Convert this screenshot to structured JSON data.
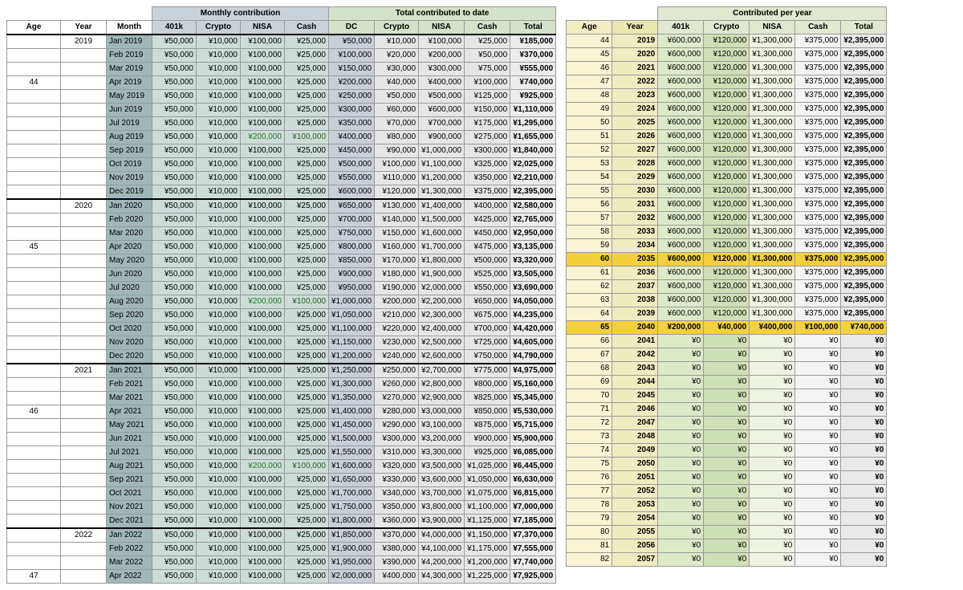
{
  "left": {
    "sup_headers": [
      "Monthly contribution",
      "Total contributed to date"
    ],
    "headers": [
      "Age",
      "Year",
      "Month",
      "401k",
      "Crypto",
      "NISA",
      "Cash",
      "DC",
      "Crypto",
      "NISA",
      "Cash",
      "Total"
    ],
    "ageMonth": 4,
    "ageStart": 44,
    "years": [
      {
        "year": 2019,
        "401k": 50000,
        "crypto": 10000,
        "nisa_base": 100000,
        "nisa_aug": 200000,
        "cash_base": 25000,
        "cash_aug": 100000
      },
      {
        "year": 2020,
        "401k": 50000,
        "crypto": 10000,
        "nisa_base": 100000,
        "nisa_aug": 200000,
        "cash_base": 25000,
        "cash_aug": 100000
      },
      {
        "year": 2021,
        "401k": 50000,
        "crypto": 10000,
        "nisa_base": 100000,
        "nisa_aug": 200000,
        "cash_base": 25000,
        "cash_aug": 100000
      },
      {
        "year": 2022,
        "401k": 50000,
        "crypto": 10000,
        "nisa_base": 100000,
        "nisa_aug": 200000,
        "cash_base": 25000,
        "cash_aug": 100000
      }
    ],
    "months": [
      "Jan",
      "Feb",
      "Mar",
      "Apr",
      "May",
      "Jun",
      "Jul",
      "Aug",
      "Sep",
      "Oct",
      "Nov",
      "Dec"
    ],
    "limitRows": 40
  },
  "right": {
    "sup_header": "Contributed per year",
    "headers": [
      "Age",
      "Year",
      "401k",
      "Crypto",
      "NISA",
      "Cash",
      "Total"
    ],
    "startAge": 44,
    "startYear": 2019,
    "endAge": 82,
    "workEndAge": 64,
    "annual": {
      "401k": 600000,
      "crypto": 120000,
      "nisa": 1300000,
      "cash": 375000,
      "total": 2395000
    },
    "partial": {
      "age": 65,
      "401k": 200000,
      "crypto": 40000,
      "nisa": 400000,
      "cash": 100000,
      "total": 740000
    },
    "goldAges": [
      60,
      65
    ]
  }
}
